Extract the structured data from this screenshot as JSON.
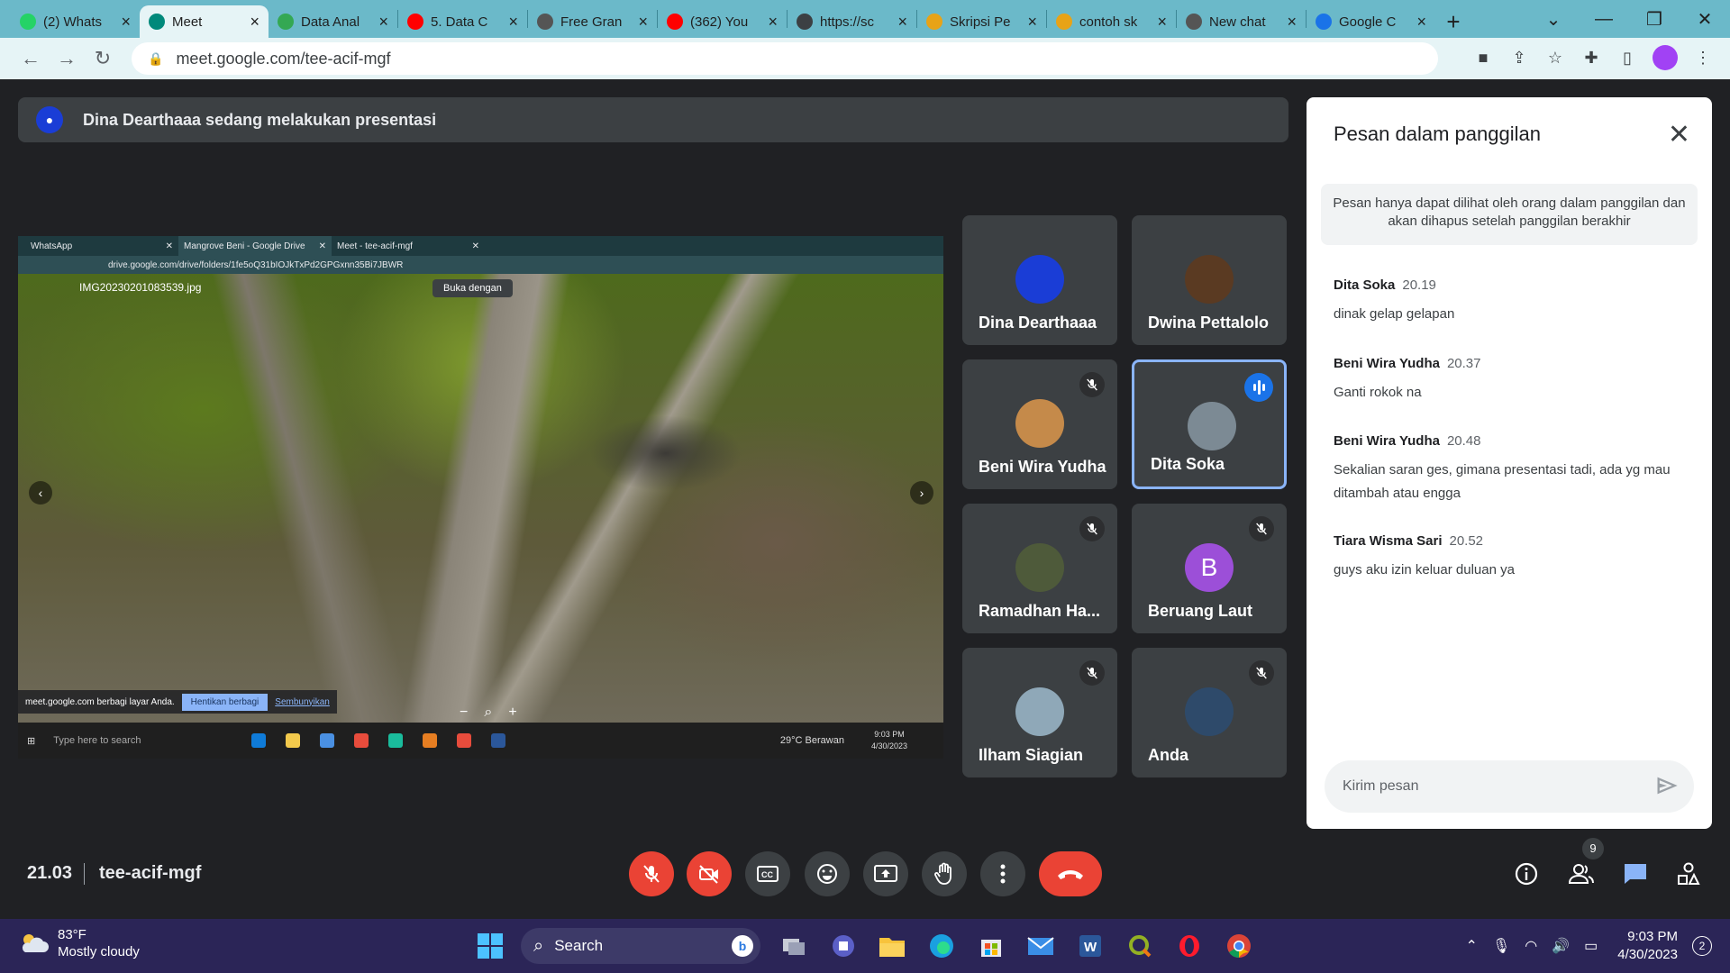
{
  "browser": {
    "tabs": [
      {
        "label": "(2) Whats",
        "icon": "whatsapp-icon",
        "color": "#25d366"
      },
      {
        "label": "Meet",
        "icon": "meet-icon",
        "color": "#00897b",
        "active": true
      },
      {
        "label": "Data Anal",
        "icon": "gear-icon",
        "color": "#34a853"
      },
      {
        "label": "5. Data C",
        "icon": "youtube-icon",
        "color": "#ff0000"
      },
      {
        "label": "Free Gran",
        "icon": "quill-icon",
        "color": "#555555"
      },
      {
        "label": "(362) You",
        "icon": "youtube-icon",
        "color": "#ff0000"
      },
      {
        "label": "https://sc",
        "icon": "globe-icon",
        "color": "#3c4043"
      },
      {
        "label": "Skripsi Pe",
        "icon": "folder-icon",
        "color": "#e8a317"
      },
      {
        "label": "contoh sk",
        "icon": "folder-icon",
        "color": "#e8a317"
      },
      {
        "label": "New chat",
        "icon": "openai-icon",
        "color": "#555555"
      },
      {
        "label": "Google C",
        "icon": "drive-icon",
        "color": "#1a73e8"
      }
    ],
    "url": "meet.google.com/tee-acif-mgf"
  },
  "presenter_bar": {
    "text": "Dina Dearthaaa sedang melakukan presentasi"
  },
  "shared_screen": {
    "tabs": [
      "WhatsApp",
      "Mangrove Beni - Google Drive",
      "Meet - tee-acif-mgf"
    ],
    "url": "drive.google.com/drive/folders/1fe5oQ31bIOJkTxPd2GPGxnn35Bi7JBWR",
    "filename": "IMG20230201083539.jpg",
    "open_with": "Buka dengan",
    "share_notice": "meet.google.com berbagi layar Anda.",
    "stop_sharing": "Hentikan berbagi",
    "hide": "Sembunyikan",
    "taskbar_search": "Type here to search",
    "weather": "29°C  Berawan",
    "time": "9:03 PM",
    "date": "4/30/2023"
  },
  "participants": [
    {
      "name": "Dina Dearthaaa",
      "avatar_color": "#1a3dd6",
      "muted": false
    },
    {
      "name": "Dwina Pettalolo",
      "avatar_color": "#5a3a22",
      "muted": false
    },
    {
      "name": "Beni Wira Yudha",
      "avatar_color": "#c58a4a",
      "muted": true
    },
    {
      "name": "Dita Soka",
      "avatar_color": "#7c8a94",
      "muted": false,
      "speaking": true
    },
    {
      "name": "Ramadhan Ha...",
      "avatar_color": "#4e5a3a",
      "muted": true
    },
    {
      "name": "Beruang Laut",
      "avatar_color": "#9c4fd8",
      "initial": "B",
      "muted": true
    },
    {
      "name": "Ilham Siagian",
      "avatar_color": "#8fa8b8",
      "muted": true
    },
    {
      "name": "Anda",
      "avatar_color": "#2e4a6a",
      "muted": true
    }
  ],
  "chat": {
    "title": "Pesan dalam panggilan",
    "notice": "Pesan hanya dapat dilihat oleh orang dalam panggilan dan akan dihapus setelah panggilan berakhir",
    "messages": [
      {
        "sender": "Dita Soka",
        "time": "20.19",
        "text": "dinak gelap gelapan"
      },
      {
        "sender": "Beni Wira Yudha",
        "time": "20.37",
        "text": "Ganti rokok na"
      },
      {
        "sender": "Beni Wira Yudha",
        "time": "20.48",
        "text": "Sekalian saran ges, gimana presentasi tadi, ada yg mau ditambah atau engga"
      },
      {
        "sender": "Tiara Wisma Sari",
        "time": "20.52",
        "text": "guys aku izin keluar duluan ya"
      }
    ],
    "input_placeholder": "Kirim pesan"
  },
  "meeting": {
    "time": "21.03",
    "code": "tee-acif-mgf",
    "participant_count": "9"
  },
  "taskbar": {
    "weather_temp": "83°F",
    "weather_desc": "Mostly cloudy",
    "search": "Search",
    "time": "9:03 PM",
    "date": "4/30/2023",
    "notifications": "2"
  }
}
